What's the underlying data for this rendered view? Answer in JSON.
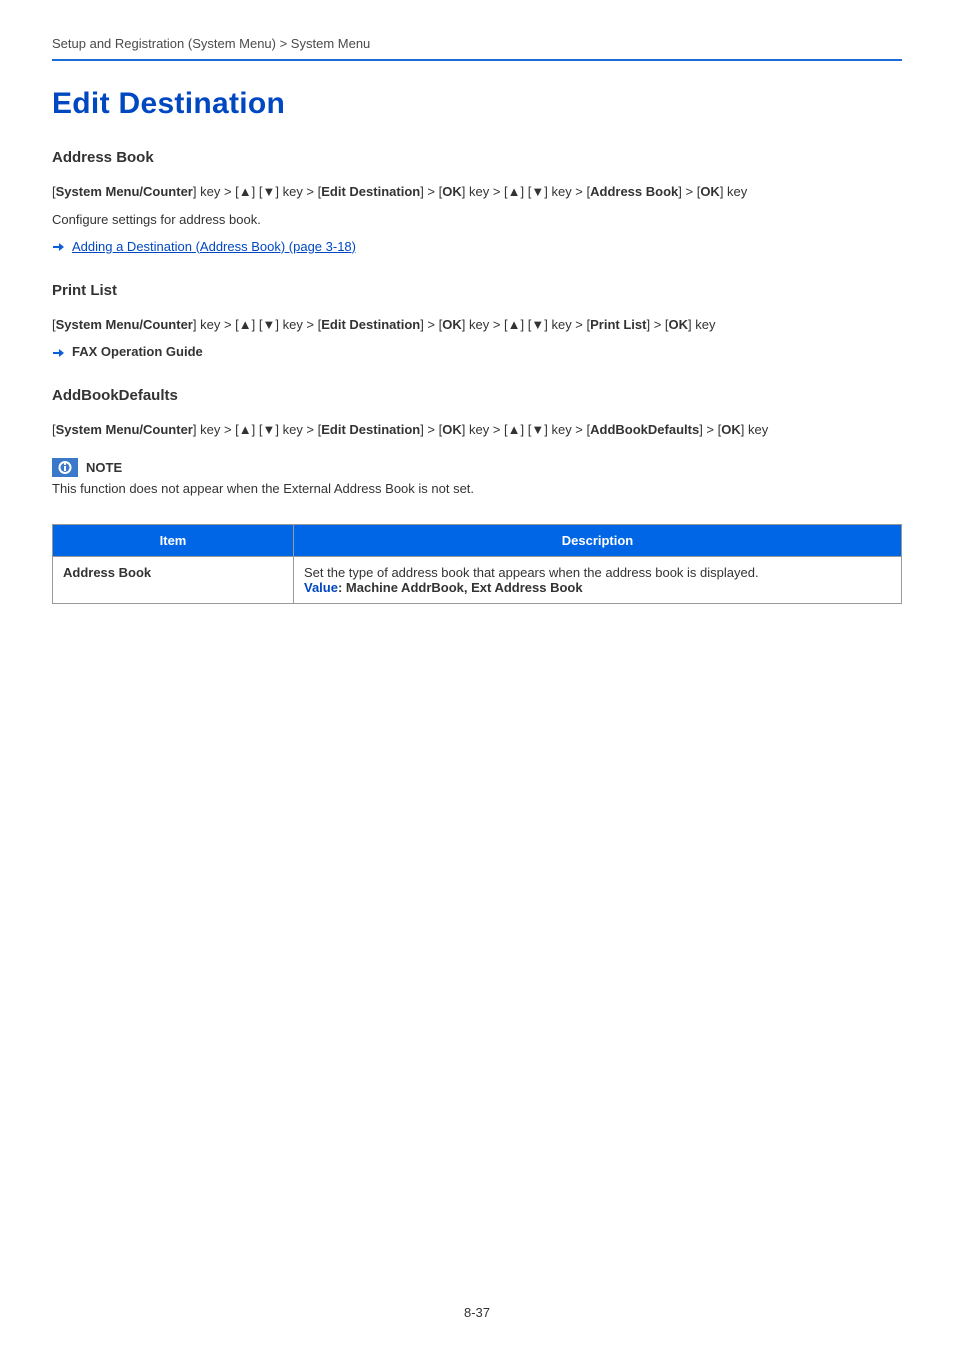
{
  "breadcrumb": "Setup and Registration (System Menu) > System Menu",
  "title": "Edit Destination",
  "sections": {
    "address_book": {
      "heading": "Address Book",
      "path_prefix1": "System Menu/Counter",
      "path_mid1": "] key > [",
      "path_up": "▲",
      "path_down": "▼",
      "path_mid2": "] key > [",
      "path_edit": "Edit Destination",
      "path_mid3": "] > [",
      "path_ok": "OK",
      "path_mid4": "] key > [",
      "path_target": "Address Book",
      "path_suffix": "] > [",
      "path_end": "] key",
      "desc": "Configure settings for address book.",
      "link": "Adding a Destination (Address Book) (page 3-18)"
    },
    "print_list": {
      "heading": "Print List",
      "path_target": "Print List",
      "link": "FAX Operation Guide"
    },
    "defaults": {
      "heading": "AddBookDefaults",
      "path_target": "AddBookDefaults",
      "note_label": "NOTE",
      "note_text": "This function does not appear when the External Address Book is not set."
    }
  },
  "table": {
    "headers": {
      "item": "Item",
      "description": "Description"
    },
    "rows": [
      {
        "item": "Address Book",
        "desc": "Set the type of address book that appears when the address book is displayed.",
        "value_label": "Value",
        "value_text": ": Machine AddrBook, Ext Address Book"
      }
    ]
  },
  "page_number": "8-37"
}
